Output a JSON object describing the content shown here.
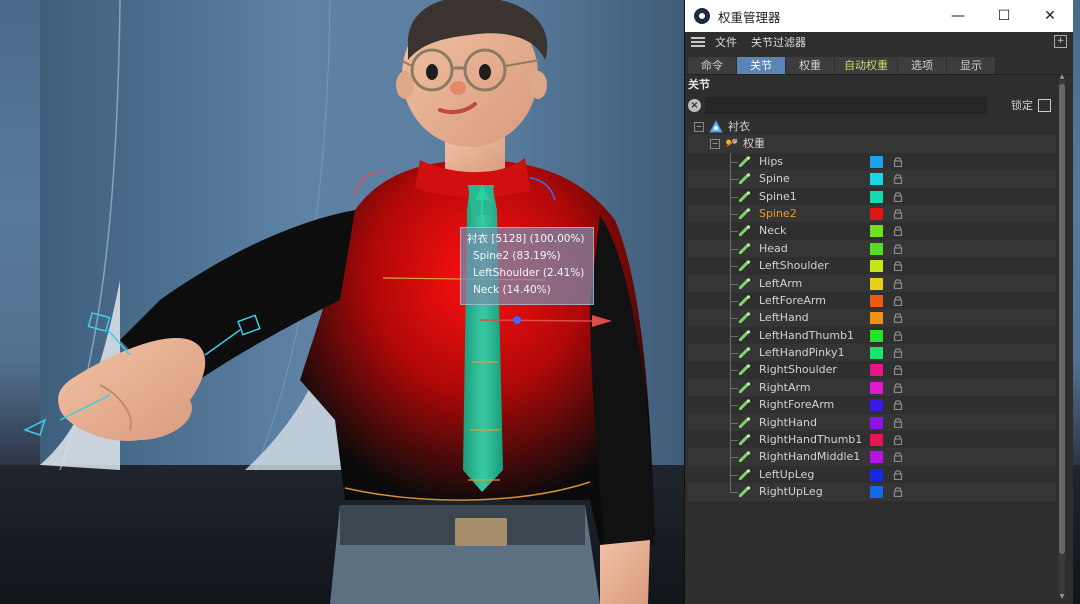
{
  "viewport": {
    "tooltip": {
      "lines": [
        "衬衣 [5128] (100.00%)",
        "Spine2 (83.19%)",
        "LeftShoulder (2.41%)",
        "Neck (14.40%)"
      ]
    }
  },
  "window": {
    "title": "权重管理器",
    "controls": {
      "minimize": "—",
      "maximize": "☐",
      "close": "✕"
    },
    "menu": [
      "文件",
      "关节过滤器"
    ],
    "tabs": [
      {
        "label": "命令",
        "active": false
      },
      {
        "label": "关节",
        "active": true
      },
      {
        "label": "权重",
        "active": false
      },
      {
        "label": "自动权重",
        "active": false
      },
      {
        "label": "选项",
        "active": false
      },
      {
        "label": "显示",
        "active": false
      }
    ],
    "section_title": "关节",
    "search": {
      "value": "",
      "placeholder": ""
    },
    "lock_label": "锁定",
    "tree": {
      "root": "衬衣",
      "weight_tag": "权重",
      "joints": [
        {
          "name": "Hips",
          "color": "#1aa3e8",
          "selected": false
        },
        {
          "name": "Spine",
          "color": "#17d6e6",
          "selected": false
        },
        {
          "name": "Spine1",
          "color": "#14d9b0",
          "selected": false
        },
        {
          "name": "Spine2",
          "color": "#e01414",
          "selected": true
        },
        {
          "name": "Neck",
          "color": "#6ee01c",
          "selected": false
        },
        {
          "name": "Head",
          "color": "#52e020",
          "selected": false
        },
        {
          "name": "LeftShoulder",
          "color": "#c6e61a",
          "selected": false
        },
        {
          "name": "LeftArm",
          "color": "#e6d114",
          "selected": false
        },
        {
          "name": "LeftForeArm",
          "color": "#ef5a12",
          "selected": false
        },
        {
          "name": "LeftHand",
          "color": "#f29114",
          "selected": false
        },
        {
          "name": "LeftHandThumb1",
          "color": "#20e62a",
          "selected": false
        },
        {
          "name": "LeftHandPinky1",
          "color": "#14e66e",
          "selected": false
        },
        {
          "name": "RightShoulder",
          "color": "#e6148c",
          "selected": false
        },
        {
          "name": "RightArm",
          "color": "#e018d0",
          "selected": false
        },
        {
          "name": "RightForeArm",
          "color": "#3a18e6",
          "selected": false
        },
        {
          "name": "RightHand",
          "color": "#8a14ea",
          "selected": false
        },
        {
          "name": "RightHandThumb1",
          "color": "#e61450",
          "selected": false
        },
        {
          "name": "RightHandMiddle1",
          "color": "#b614e6",
          "selected": false
        },
        {
          "name": "LeftUpLeg",
          "color": "#1428e6",
          "selected": false
        },
        {
          "name": "RightUpLeg",
          "color": "#146ae6",
          "selected": false
        }
      ]
    }
  }
}
